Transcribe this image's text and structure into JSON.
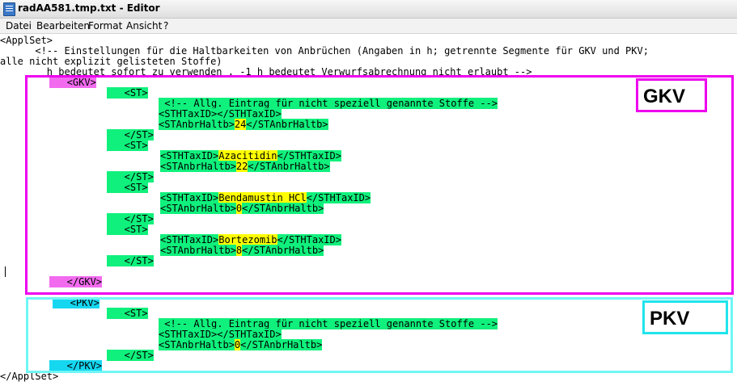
{
  "window": {
    "title": "radAA581.tmp.txt - Editor"
  },
  "menu": [
    "Datei",
    "Bearbeiten",
    "Format",
    "Ansicht",
    "?"
  ],
  "lines": {
    "l1": "<ApplSet>",
    "l2": "      <!-- Einstellungen für die Haltbarkeiten von Anbrüchen (Angaben in h; getrennte Segmente für GKV und PKV;",
    "l3": "alle nicht explizit gelisteten Stoffe)",
    "l4": "        h bedeutet sofort zu verwenden , -1 h bedeutet Verwurfsabrechnung nicht erlaubt -->",
    "gkv_open": "   <GKV>",
    "st1_open": "   <ST>",
    "comment1": " <!-- Allg. Eintrag für nicht speziell genannte Stoffe -->",
    "tax1": "<STHTaxID></STHTaxID>",
    "anbr1_open": "<STAnbrHaltb>",
    "anbr1_val": "24",
    "anbr1_close": "</STAnbrHaltb>",
    "st1_close": "   </ST>",
    "st2_open": "   <ST>",
    "tax2_open": "<STHTaxID>",
    "tax2_val": "Azacitidin",
    "tax2_close": "</STHTaxID>",
    "anbr2_open": "<STAnbrHaltb>",
    "anbr2_val": "22",
    "anbr2_close": "</STAnbrHaltb>",
    "st2_close": "   </ST>",
    "st3_open": "   <ST>",
    "tax3_open": "<STHTaxID>",
    "tax3_val": "Bendamustin HCl",
    "tax3_close": "</STHTaxID>",
    "anbr3_open": "<STAnbrHaltb>",
    "anbr3_val": "0",
    "anbr3_close": "</STAnbrHaltb>",
    "st3_close": "   </ST>",
    "st4_open": "   <ST>",
    "tax4_open": "<STHTaxID>",
    "tax4_val": "Bortezomib",
    "tax4_close": "</STHTaxID>",
    "anbr4_open": "<STAnbrHaltb>",
    "anbr4_val": "8",
    "anbr4_close": "</STAnbrHaltb>",
    "st4_close": "   </ST>",
    "gkv_close": "   </GKV>",
    "pkv_open": "   <PKV>",
    "pst_open": "   <ST>",
    "pcomment": " <!-- Allg. Eintrag für nicht speziell genannte Stoffe -->",
    "ptax": "<STHTaxID></STHTaxID>",
    "panbr_open": "<STAnbrHaltb>",
    "panbr_val": "0",
    "panbr_close": "</STAnbrHaltb>",
    "pst_close": "   </ST>",
    "pkv_close": "   </PKV>",
    "end": "</ApplSet>"
  },
  "annotations": {
    "gkv_label": "GKV",
    "pkv_label": "PKV"
  },
  "colors": {
    "tag_green": "#10f07c",
    "tag_magenta": "#f26bef",
    "tag_cyan": "#16d7f0",
    "value_yellow": "#ffff00",
    "gkv_box": "#ee00ee",
    "pkv_box": "#6ff6f6"
  }
}
